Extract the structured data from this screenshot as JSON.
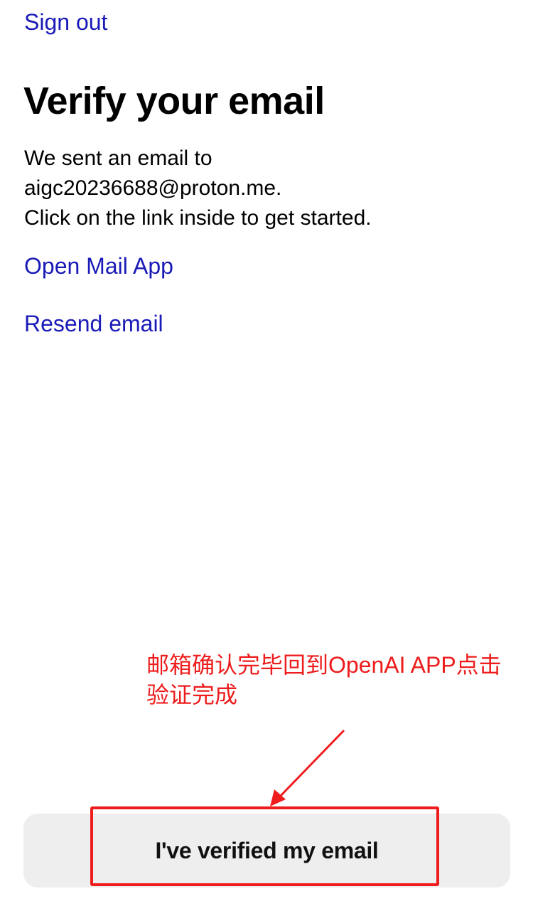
{
  "nav": {
    "sign_out_label": "Sign out"
  },
  "page": {
    "title": "Verify your email",
    "message_lines": [
      "We sent an email to",
      "aigc20236688@proton.me.",
      "Click on the link inside to get started."
    ]
  },
  "actions": {
    "open_mail_label": "Open Mail App",
    "resend_label": "Resend email",
    "verified_button_label": "I've verified my email"
  },
  "annotation": {
    "lines": [
      "邮箱确认完毕回到OpenAI APP点击",
      "验证完成"
    ],
    "color": "#ee1c1c"
  },
  "colors": {
    "link": "#1a1ab8",
    "button_bg": "#eeeeee",
    "text": "#000000"
  }
}
